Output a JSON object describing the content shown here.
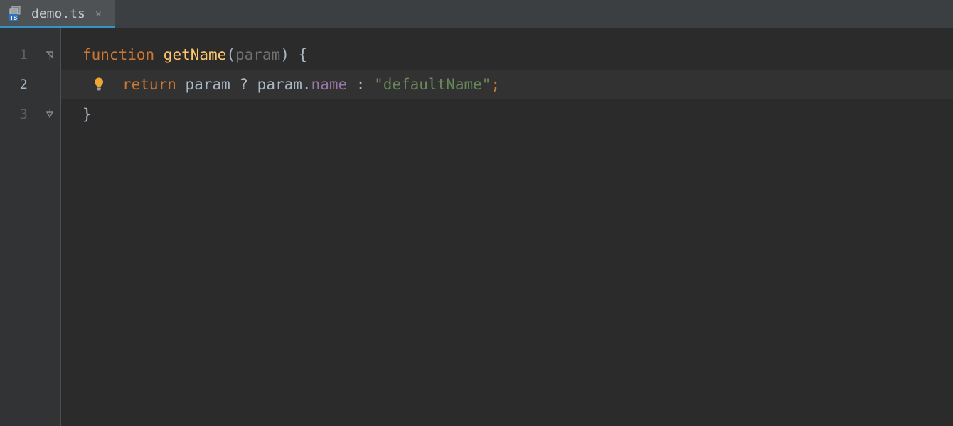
{
  "tab": {
    "filename": "demo.ts",
    "icon": "typescript-file-icon",
    "close_tooltip": "Close"
  },
  "editor": {
    "current_line": 2,
    "lines": [
      {
        "n": 1,
        "fold": "open",
        "tokens": [
          {
            "t": "function ",
            "c": "kw"
          },
          {
            "t": "getName",
            "c": "fn"
          },
          {
            "t": "(",
            "c": "punc"
          },
          {
            "t": "param",
            "c": "ghost"
          },
          {
            "t": ")",
            "c": "punc"
          },
          {
            "t": " {",
            "c": "punc"
          }
        ]
      },
      {
        "n": 2,
        "hint": "bulb",
        "highlight": true,
        "tokens": [
          {
            "t": "INDENT",
            "c": "indent"
          },
          {
            "t": "return ",
            "c": "kw"
          },
          {
            "t": "param ",
            "c": "ident"
          },
          {
            "t": "? ",
            "c": "punc"
          },
          {
            "t": "param",
            "c": "ident"
          },
          {
            "t": ".",
            "c": "punc"
          },
          {
            "t": "name ",
            "c": "prop"
          },
          {
            "t": ": ",
            "c": "punc"
          },
          {
            "t": "\"defaultName\"",
            "c": "str"
          },
          {
            "t": ";",
            "c": "semi"
          }
        ]
      },
      {
        "n": 3,
        "fold": "close",
        "tokens": [
          {
            "t": "}",
            "c": "punc"
          }
        ]
      }
    ]
  }
}
